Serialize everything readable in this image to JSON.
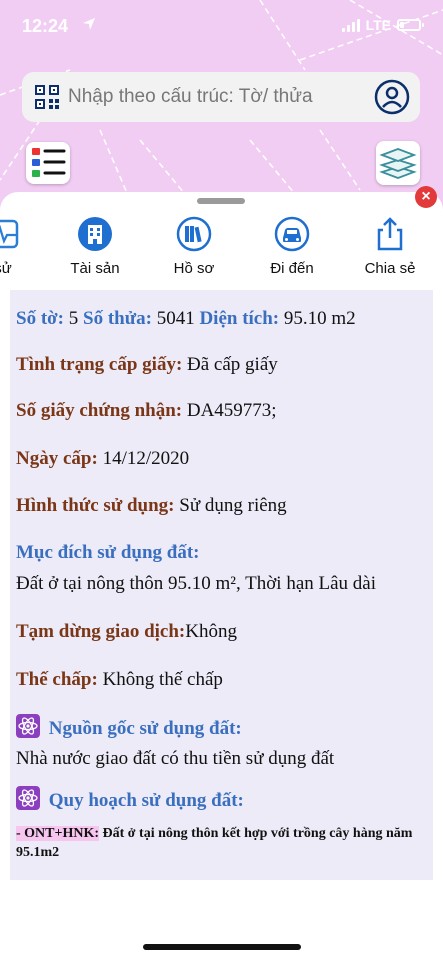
{
  "status": {
    "time": "12:24",
    "network": "LTE"
  },
  "search": {
    "placeholder": "Nhập theo cấu trúc: Tờ/ thửa"
  },
  "toolbar": {
    "items": [
      {
        "label": "sử",
        "icon": "pulse-icon"
      },
      {
        "label": "Tài sản",
        "icon": "building-icon"
      },
      {
        "label": "Hồ sơ",
        "icon": "books-icon"
      },
      {
        "label": "Đi đến",
        "icon": "car-icon"
      },
      {
        "label": "Chia sẻ",
        "icon": "share-icon"
      }
    ]
  },
  "close": {
    "label": "×"
  },
  "info": {
    "so_to_label": "Số tờ:",
    "so_to_value": "5",
    "so_thua_label": "Số thửa:",
    "so_thua_value": "5041",
    "dien_tich_label": "Diện tích:",
    "dien_tich_value": "95.10 m2",
    "tinh_trang_label": "Tình trạng cấp giấy:",
    "tinh_trang_value": "Đã cấp giấy",
    "so_giay_label": "Số giấy chứng nhận:",
    "so_giay_value": "DA459773;",
    "ngay_cap_label": "Ngày cấp:",
    "ngay_cap_value": "14/12/2020",
    "hinh_thuc_label": "Hình thức sử dụng:",
    "hinh_thuc_value": "Sử dụng riêng",
    "muc_dich_label": "Mục đích sử dụng đất:",
    "muc_dich_value": "Đất ở tại nông thôn 95.10 m², Thời hạn Lâu dài",
    "tam_dung_label": "Tạm dừng giao dịch:",
    "tam_dung_value": "Không",
    "the_chap_label": "Thế chấp:",
    "the_chap_value": "Không thế chấp",
    "nguon_goc_label": "Nguồn gốc sử dụng đất:",
    "nguon_goc_value": "Nhà nước giao đất có thu tiền sử dụng đất",
    "quy_hoach_label": "Quy hoạch sử dụng đất:",
    "quy_hoach_tag": "- ONT+HNK:",
    "quy_hoach_value": "Đất ở tại nông thôn kết hợp với trồng cây hàng năm 95.1m2"
  },
  "colors": {
    "map_bg": "#f2cdf3",
    "label_blue": "#3a6fbf",
    "label_brown": "#7a3616",
    "panel_bg": "#ecebf7",
    "close_red": "#e23a3a"
  }
}
